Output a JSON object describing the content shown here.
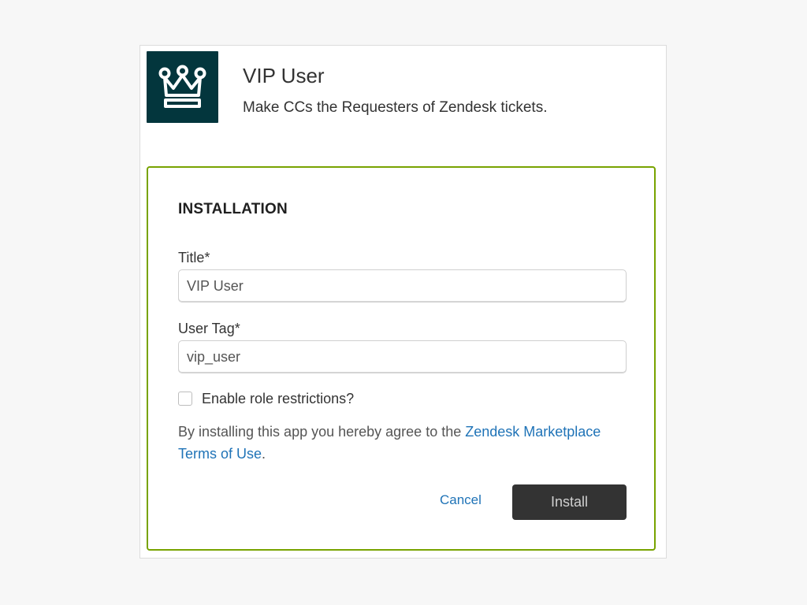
{
  "app": {
    "name": "VIP User",
    "description": "Make CCs the Requesters of Zendesk tickets.",
    "logo_icon": "crown-icon",
    "logo_bg_color": "#03363d"
  },
  "installation": {
    "heading": "INSTALLATION",
    "accent_color": "#78a300",
    "fields": [
      {
        "label": "Title*",
        "value": "VIP User",
        "placeholder": ""
      },
      {
        "label": "User Tag*",
        "value": "vip_user",
        "placeholder": ""
      }
    ],
    "role_restrictions": {
      "label": "Enable role restrictions?",
      "checked": false
    },
    "terms": {
      "prefix": "By installing this app you hereby agree to the ",
      "link_text": "Zendesk Marketplace Terms of Use",
      "suffix": "."
    },
    "cancel_label": "Cancel",
    "install_label": "Install"
  }
}
